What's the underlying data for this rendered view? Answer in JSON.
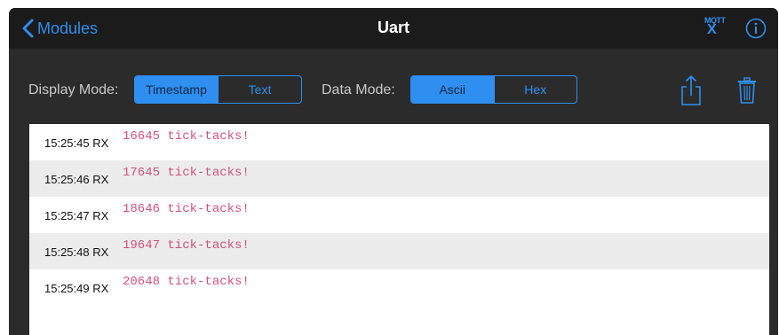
{
  "nav": {
    "back_label": "Modules",
    "title": "Uart",
    "mqtt_top": "MQTT",
    "mqtt_x": "X"
  },
  "toolbar": {
    "display_mode_label": "Display Mode:",
    "display_mode_options": [
      "Timestamp",
      "Text"
    ],
    "display_mode_selected": "Timestamp",
    "data_mode_label": "Data Mode:",
    "data_mode_options": [
      "Ascii",
      "Hex"
    ],
    "data_mode_selected": "Ascii"
  },
  "log": {
    "rows": [
      {
        "timestamp": "15:25:45 RX",
        "message": "16645 tick-tacks!"
      },
      {
        "timestamp": "15:25:46 RX",
        "message": "17645 tick-tacks!"
      },
      {
        "timestamp": "15:25:47 RX",
        "message": "18646 tick-tacks!"
      },
      {
        "timestamp": "15:25:48 RX",
        "message": "19647 tick-tacks!"
      },
      {
        "timestamp": "15:25:49 RX",
        "message": "20648 tick-tacks!"
      }
    ]
  },
  "colors": {
    "accent": "#2e8ff0",
    "navbar": "#1b1b1b",
    "toolbar": "#2b2b2b",
    "message_text": "#d1527a",
    "alt_row": "#ececec"
  },
  "icons": {
    "back": "chevron-left-icon",
    "mqtt": "mqtt-icon",
    "info": "info-icon",
    "share": "share-icon",
    "trash": "trash-icon"
  }
}
